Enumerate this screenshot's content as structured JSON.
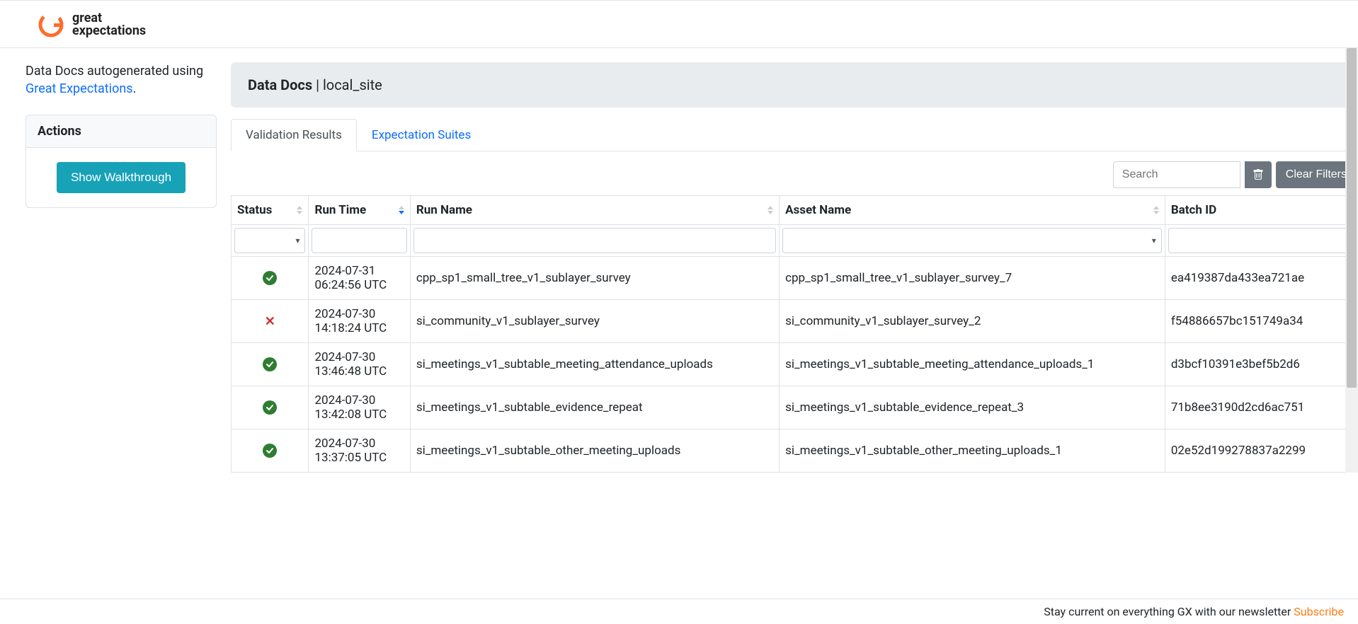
{
  "logo": {
    "line1": "great",
    "line2": "expectations"
  },
  "intro": {
    "text_before": "Data Docs autogenerated using ",
    "link_text": "Great Expectations",
    "text_after": "."
  },
  "actions": {
    "title": "Actions",
    "walkthrough_label": "Show Walkthrough"
  },
  "header": {
    "title": "Data Docs",
    "separator": " | ",
    "site": "local_site"
  },
  "tabs": {
    "validation": "Validation Results",
    "expectation": "Expectation Suites"
  },
  "controls": {
    "search_placeholder": "Search",
    "clear_label": "Clear Filters"
  },
  "columns": {
    "status": "Status",
    "run_time": "Run Time",
    "run_name": "Run Name",
    "asset_name": "Asset Name",
    "batch_id": "Batch ID"
  },
  "rows": [
    {
      "status": "pass",
      "run_time": "2024-07-31 06:24:56 UTC",
      "run_name": "cpp_sp1_small_tree_v1_sublayer_survey",
      "asset_name": "cpp_sp1_small_tree_v1_sublayer_survey_7",
      "batch_id": "ea419387da433ea721ae"
    },
    {
      "status": "fail",
      "run_time": "2024-07-30 14:18:24 UTC",
      "run_name": "si_community_v1_sublayer_survey",
      "asset_name": "si_community_v1_sublayer_survey_2",
      "batch_id": "f54886657bc151749a34"
    },
    {
      "status": "pass",
      "run_time": "2024-07-30 13:46:48 UTC",
      "run_name": "si_meetings_v1_subtable_meeting_attendance_uploads",
      "asset_name": "si_meetings_v1_subtable_meeting_attendance_uploads_1",
      "batch_id": "d3bcf10391e3bef5b2d6"
    },
    {
      "status": "pass",
      "run_time": "2024-07-30 13:42:08 UTC",
      "run_name": "si_meetings_v1_subtable_evidence_repeat",
      "asset_name": "si_meetings_v1_subtable_evidence_repeat_3",
      "batch_id": "71b8ee3190d2cd6ac751"
    },
    {
      "status": "pass",
      "run_time": "2024-07-30 13:37:05 UTC",
      "run_name": "si_meetings_v1_subtable_other_meeting_uploads",
      "asset_name": "si_meetings_v1_subtable_other_meeting_uploads_1",
      "batch_id": "02e52d199278837a2299"
    }
  ],
  "footer": {
    "text": "Stay current on everything GX with our newsletter ",
    "link": "Subscribe"
  }
}
